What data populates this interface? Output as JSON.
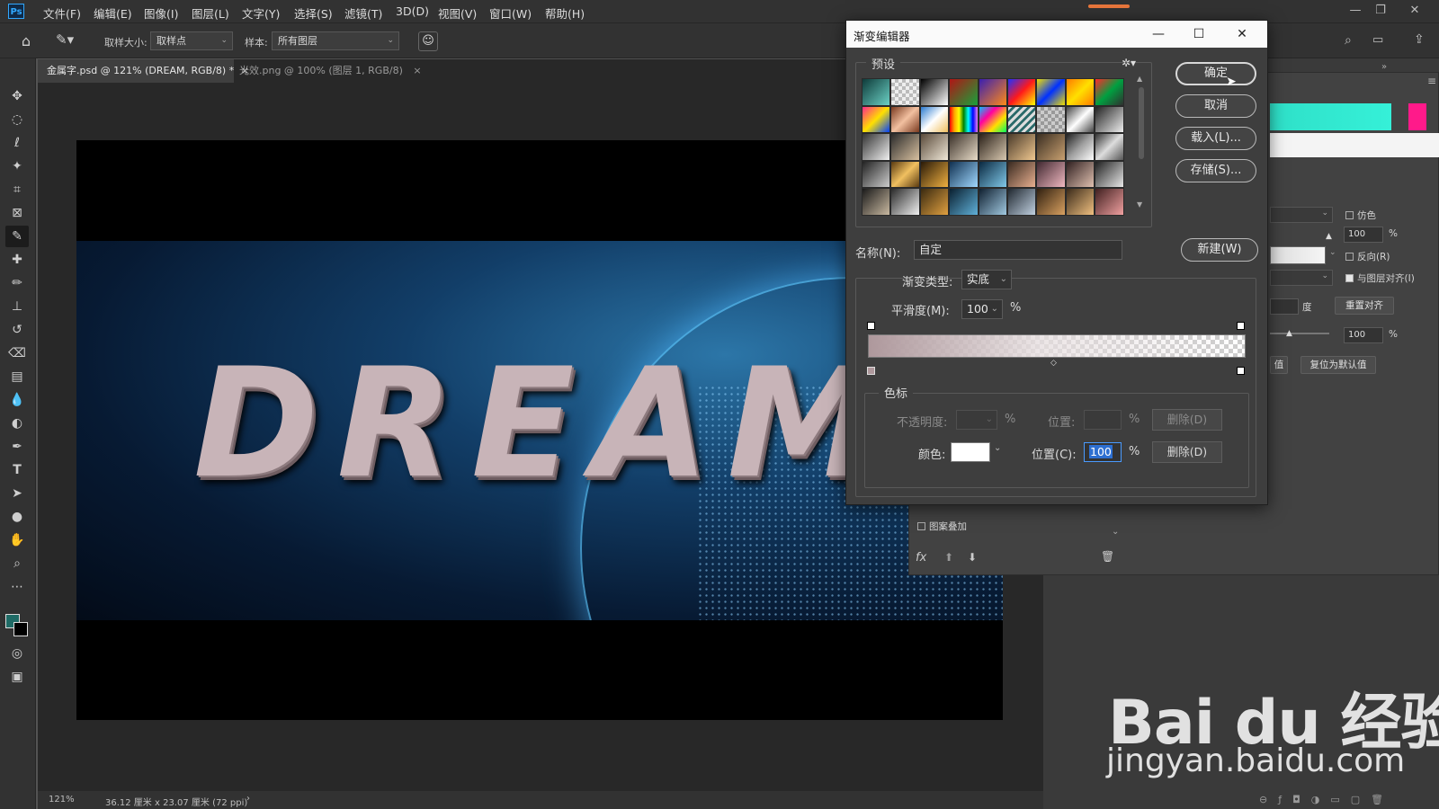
{
  "app": {
    "logo": "Ps"
  },
  "menu": [
    "文件(F)",
    "编辑(E)",
    "图像(I)",
    "图层(L)",
    "文字(Y)",
    "选择(S)",
    "滤镜(T)",
    "3D(D)",
    "视图(V)",
    "窗口(W)",
    "帮助(H)"
  ],
  "options": {
    "sample_size_label": "取样大小:",
    "sample_size_value": "取样点",
    "sample_label": "样本:",
    "sample_value": "所有图层"
  },
  "tabs": [
    {
      "label": "金属字.psd @ 121% (DREAM, RGB/8) *",
      "close": "×"
    },
    {
      "label": "光效.png @ 100% (图层 1, RGB/8)",
      "close": "×"
    }
  ],
  "canvas": {
    "text": "DREAM"
  },
  "status": {
    "zoom": "121%",
    "doc_size": "36.12 厘米 x 23.07 厘米 (72 ppi)",
    "arrow": "›"
  },
  "dialog": {
    "title": "渐变编辑器",
    "presets_label": "预设",
    "buttons": {
      "ok": "确定",
      "cancel": "取消",
      "load": "载入(L)...",
      "save": "存储(S)...",
      "new": "新建(W)"
    },
    "name_label": "名称(N):",
    "name_value": "自定",
    "gradient_type_label": "渐变类型:",
    "gradient_type_value": "实底",
    "smoothness_label": "平滑度(M):",
    "smoothness_value": "100",
    "percent": "%",
    "stops_label": "色标",
    "opacity_label": "不透明度:",
    "location_label": "位置:",
    "delete_label": "删除(D)",
    "color_label": "颜色:",
    "color_location_label": "位置(C):",
    "color_location_value": "100"
  },
  "layer_style": {
    "dither": "仿色",
    "reverse": "反向(R)",
    "align": "与图层对齐(I)",
    "opacity_value": "100",
    "percent": "%",
    "angle_unit": "度",
    "reset_align": "重置对齐",
    "scale_value": "100",
    "reset_default": "复位为默认值",
    "partial_btn": "值",
    "pattern_overlay": "图案叠加",
    "fx": "fx"
  },
  "watermark": {
    "brand": "Bai du 经验",
    "url": "jingyan.baidu.com"
  },
  "colors": {
    "accent": "#31a8ff",
    "cyan": "#2fe0c8",
    "pink": "#ff1a8a",
    "selection": "#2d6fd1"
  }
}
